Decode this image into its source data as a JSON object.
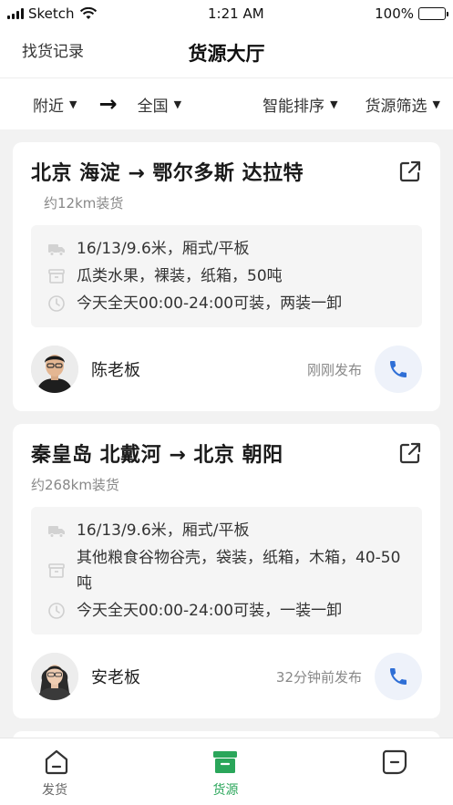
{
  "status_bar": {
    "carrier": "Sketch",
    "time": "1:21 AM",
    "battery": "100%"
  },
  "nav": {
    "left_link": "找货记录",
    "title": "货源大厅"
  },
  "filters": {
    "nearby": "附近",
    "arrow": "→",
    "nationwide": "全国",
    "sort": "智能排序",
    "filter": "货源筛选"
  },
  "cards": [
    {
      "route": "北京 海淀 → 鄂尔多斯 达拉特",
      "distance": "约12km装货",
      "vehicle": "16/13/9.6米，厢式/平板",
      "goods": "瓜类水果，裸装，纸箱，50吨",
      "schedule": "今天全天00:00-24:00可装，两装一卸",
      "owner": "陈老板",
      "published": "刚刚发布"
    },
    {
      "route": "秦皇岛 北戴河 → 北京 朝阳",
      "distance": "约268km装货",
      "vehicle": "16/13/9.6米，厢式/平板",
      "goods": "其他粮食谷物谷壳，袋装，纸箱，木箱，40-50吨",
      "schedule": "今天全天00:00-24:00可装，一装一卸",
      "owner": "安老板",
      "published": "32分钟前发布"
    }
  ],
  "tabs": {
    "ship": "发货",
    "cargo": "货源"
  },
  "colors": {
    "accent_green": "#2aa65a",
    "call_blue": "#2f6fd6"
  }
}
